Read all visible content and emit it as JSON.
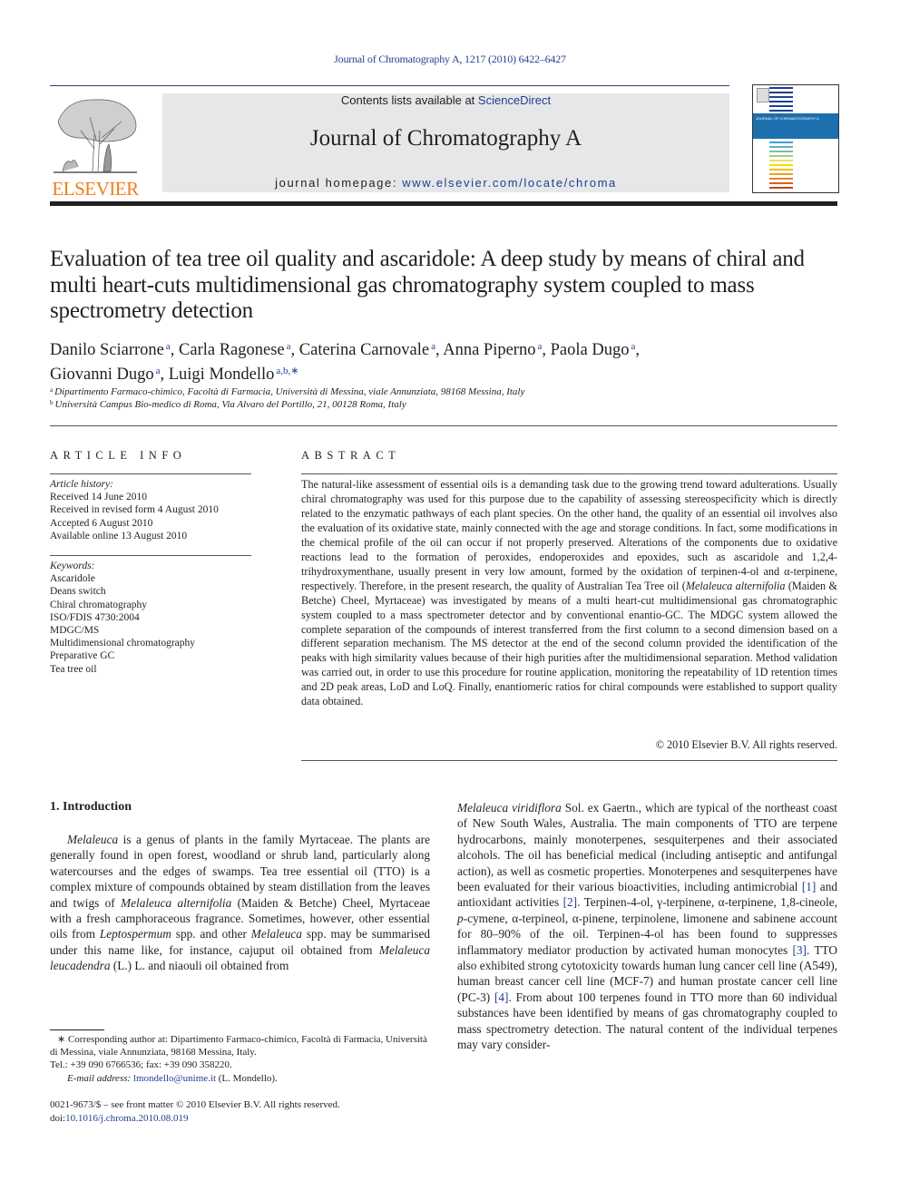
{
  "citation": "Journal of Chromatography A, 1217 (2010) 6422–6427",
  "header": {
    "publisher_logo_text": "ELSEVIER",
    "contents_prefix": "Contents lists available at ",
    "contents_link": "ScienceDirect",
    "journal_title": "Journal of Chromatography A",
    "homepage_prefix": "journal homepage: ",
    "homepage_link": "www.elsevier.com/locate/chroma",
    "cover_title": "JOURNAL OF CHROMATOGRAPHY A",
    "accent_color": "#1f3f8f",
    "logo_color": "#f07f18"
  },
  "article": {
    "title": "Evaluation of tea tree oil quality and ascaridole: A deep study by means of chiral and multi heart-cuts multidimensional gas chromatography system coupled to mass spectrometry detection",
    "authors": [
      {
        "name": "Danilo Sciarrone",
        "sup": "a"
      },
      {
        "name": "Carla Ragonese",
        "sup": "a"
      },
      {
        "name": "Caterina Carnovale",
        "sup": "a"
      },
      {
        "name": "Anna Piperno",
        "sup": "a"
      },
      {
        "name": "Paola Dugo",
        "sup": "a"
      },
      {
        "name": "Giovanni Dugo",
        "sup": "a"
      },
      {
        "name": "Luigi Mondello",
        "sup": "a,b,∗"
      }
    ],
    "affiliations": [
      {
        "mark": "a",
        "text": "Dipartimento Farmaco-chimico, Facoltà di Farmacia, Università di Messina, viale Annunziata, 98168 Messina, Italy"
      },
      {
        "mark": "b",
        "text": "Università Campus Bio-medico di Roma, Via Alvaro del Portillo, 21, 00128 Roma, Italy"
      }
    ]
  },
  "article_info": {
    "heading": "ARTICLE INFO",
    "history_label": "Article history:",
    "history": [
      "Received 14 June 2010",
      "Received in revised form 4 August 2010",
      "Accepted 6 August 2010",
      "Available online 13 August 2010"
    ],
    "keywords_label": "Keywords:",
    "keywords": [
      "Ascaridole",
      "Deans switch",
      "Chiral chromatography",
      "ISO/FDIS 4730:2004",
      "MDGC/MS",
      "Multidimensional chromatography",
      "Preparative GC",
      "Tea tree oil"
    ]
  },
  "abstract": {
    "heading": "ABSTRACT",
    "text_1": "The natural-like assessment of essential oils is a demanding task due to the growing trend toward adulterations. Usually chiral chromatography was used for this purpose due to the capability of assessing stereospecificity which is directly related to the enzymatic pathways of each plant species. On the other hand, the quality of an essential oil involves also the evaluation of its oxidative state, mainly connected with the age and storage conditions. In fact, some modifications in the chemical profile of the oil can occur if not properly preserved. Alterations of the components due to oxidative reactions lead to the formation of peroxides, endoperoxides and epoxides, such as ascaridole and 1,2,4-trihydroxymenthane, usually present in very low amount, formed by the oxidation of terpinen-4-ol and α-terpinene, respectively. Therefore, in the present research, the quality of Australian Tea Tree oil (",
    "species": "Melaleuca alternifolia",
    "text_2": " (Maiden & Betche) Cheel, Myrtaceae) was investigated by means of a multi heart-cut multidimensional gas chromatographic system coupled to a mass spectrometer detector and by conventional enantio-GC. The MDGC system allowed the complete separation of the compounds of interest transferred from the first column to a second dimension based on a different separation mechanism. The MS detector at the end of the second column provided the identification of the peaks with high similarity values because of their high purities after the multidimensional separation. Method validation was carried out, in order to use this procedure for routine application, monitoring the repeatability of 1D retention times and 2D peak areas, LoD and LoQ. Finally, enantiomeric ratios for chiral compounds were established to support quality data obtained.",
    "copyright": "© 2010 Elsevier B.V. All rights reserved."
  },
  "introduction": {
    "heading": "1.  Introduction",
    "left": [
      {
        "t": "i",
        "v": "Melaleuca"
      },
      {
        "t": "n",
        "v": " is a genus of plants in the family Myrtaceae. The plants are generally found in open forest, woodland or shrub land, particularly along watercourses and the edges of swamps. Tea tree essential oil (TTO) is a complex mixture of compounds obtained by steam distillation from the leaves and twigs of "
      },
      {
        "t": "i",
        "v": "Melaleuca alternifolia"
      },
      {
        "t": "n",
        "v": " (Maiden & Betche) Cheel, Myrtaceae with a fresh camphoraceous fragrance. Sometimes, however, other essential oils from "
      },
      {
        "t": "i",
        "v": "Leptospermum"
      },
      {
        "t": "n",
        "v": " spp. and other "
      },
      {
        "t": "i",
        "v": "Melaleuca"
      },
      {
        "t": "n",
        "v": " spp. may be summarised under this name like, for instance, cajuput oil obtained from "
      },
      {
        "t": "i",
        "v": "Melaleuca leucadendra"
      },
      {
        "t": "n",
        "v": " (L.) L. and niaouli oil obtained from"
      }
    ],
    "right": [
      {
        "t": "i",
        "v": "Melaleuca viridiflora"
      },
      {
        "t": "n",
        "v": " Sol. ex Gaertn., which are typical of the northeast coast of New South Wales, Australia. The main components of TTO are terpene hydrocarbons, mainly monoterpenes, sesquiterpenes and their associated alcohols. The oil has beneficial medical (including antiseptic and antifungal action), as well as cosmetic properties. Monoterpenes and sesquiterpenes have been evaluated for their various bioactivities, including antimicrobial "
      },
      {
        "t": "r",
        "v": "[1]"
      },
      {
        "t": "n",
        "v": " and antioxidant activities "
      },
      {
        "t": "r",
        "v": "[2]"
      },
      {
        "t": "n",
        "v": ". Terpinen-4-ol, γ-terpinene, α-terpinene, 1,8-cineole, "
      },
      {
        "t": "i",
        "v": "p"
      },
      {
        "t": "n",
        "v": "-cymene, α-terpineol, α-pinene, terpinolene, limonene and sabinene account for 80–90% of the oil. Terpinen-4-ol has been found to suppresses inflammatory mediator production by activated human monocytes "
      },
      {
        "t": "r",
        "v": "[3]"
      },
      {
        "t": "n",
        "v": ". TTO also exhibited strong cytotoxicity towards human lung cancer cell line (A549), human breast cancer cell line (MCF-7) and human prostate cancer cell line (PC-3) "
      },
      {
        "t": "r",
        "v": "[4]"
      },
      {
        "t": "n",
        "v": ". From about 100 terpenes found in TTO more than 60 individual substances have been identified by means of gas chromatography coupled to mass spectrometry detection. The natural content of the individual terpenes may vary consider-"
      }
    ]
  },
  "footnote": {
    "corresponding": "∗ Corresponding author at: Dipartimento Farmaco-chimico, Facoltà di Farmacia, Università di Messina, viale Annunziata, 98168 Messina, Italy.",
    "tel": "Tel.: +39 090 6766536; fax: +39 090 358220.",
    "email_label": "E-mail address: ",
    "email": "lmondello@unime.it",
    "email_suffix": " (L. Mondello)."
  },
  "front_matter": {
    "issn_line": "0021-9673/$ – see front matter © 2010 Elsevier B.V. All rights reserved.",
    "doi_label": "doi:",
    "doi": "10.1016/j.chroma.2010.08.019"
  }
}
